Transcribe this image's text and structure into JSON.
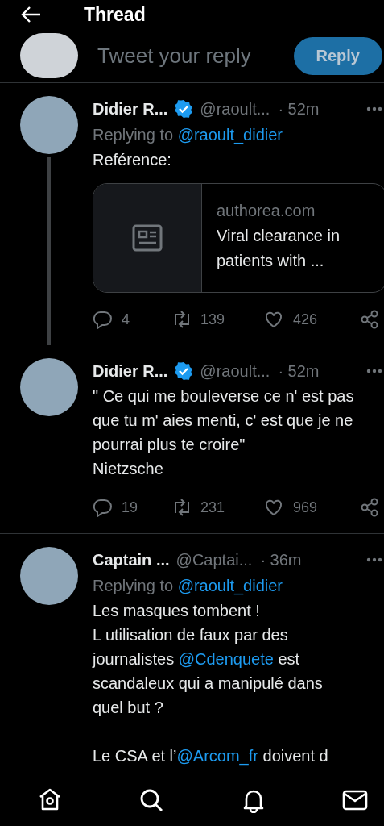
{
  "header": {
    "title": "Thread"
  },
  "compose": {
    "placeholder": "Tweet your reply",
    "button": "Reply"
  },
  "tweets": [
    {
      "name": "Didier R...",
      "verified": true,
      "handle": "@raoult...",
      "time": "· 52m",
      "replying_label": "Replying to",
      "replying_to": "@raoult_didier",
      "thread_line": true,
      "paragraphs": [
        [
          [
            {
              "kind": "text",
              "text": "Reférence:"
            }
          ]
        ]
      ],
      "card": {
        "domain": "authorea.com",
        "title_lines": [
          "Viral clearance in",
          "patients with ..."
        ]
      },
      "actions": {
        "replies": "4",
        "retweets": "139",
        "likes": "426"
      }
    },
    {
      "name": "Didier R...",
      "verified": true,
      "handle": "@raoult...",
      "time": "· 52m",
      "thread_line": false,
      "paragraphs": [
        [
          [
            {
              "kind": "text",
              "text": "\" Ce qui me bouleverse ce n' est pas"
            }
          ],
          [
            {
              "kind": "text",
              "text": "que tu m' aies menti, c' est que je ne"
            }
          ],
          [
            {
              "kind": "text",
              "text": "pourrai plus te croire\""
            }
          ],
          [
            {
              "kind": "text",
              "text": "Nietzsche"
            }
          ]
        ]
      ],
      "actions": {
        "replies": "19",
        "retweets": "231",
        "likes": "969"
      }
    },
    {
      "name": "Captain ...",
      "verified": false,
      "handle": "@Captai...",
      "time": "· 36m",
      "replying_label": "Replying to",
      "replying_to": "@raoult_didier",
      "thread_line": false,
      "paragraphs": [
        [
          [
            {
              "kind": "text",
              "text": "Les masques tombent !"
            }
          ],
          [
            {
              "kind": "text",
              "text": "L utilisation de faux par des"
            }
          ],
          [
            {
              "kind": "text",
              "text": "journalistes "
            },
            {
              "kind": "mention",
              "text": "@Cdenquete"
            },
            {
              "kind": "text",
              "text": " est"
            }
          ],
          [
            {
              "kind": "text",
              "text": "scandaleux qui a manipulé dans"
            }
          ],
          [
            {
              "kind": "text",
              "text": "quel but ?"
            }
          ]
        ],
        [
          [
            {
              "kind": "text",
              "text": "Le CSA et l’"
            },
            {
              "kind": "mention",
              "text": "@Arcom_fr"
            },
            {
              "kind": "text",
              "text": " doivent d"
            }
          ]
        ]
      ]
    }
  ],
  "nav": [
    {
      "kind": "home"
    },
    {
      "kind": "search"
    },
    {
      "kind": "notifications"
    },
    {
      "kind": "messages"
    }
  ]
}
